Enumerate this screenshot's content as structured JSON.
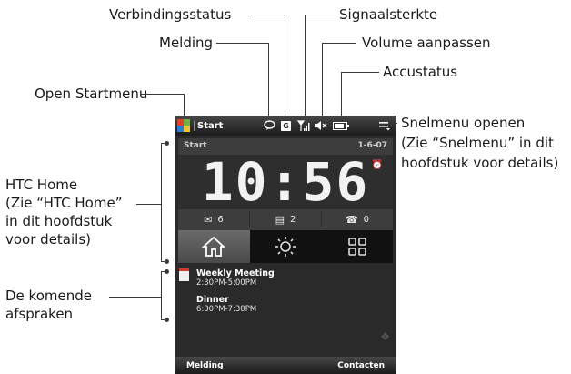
{
  "callouts": {
    "verbindingsstatus": "Verbindingsstatus",
    "signaalsterkte": "Signaalsterkte",
    "melding": "Melding",
    "volume": "Volume aanpassen",
    "accustatus": "Accustatus",
    "open_startmenu": "Open Startmenu",
    "snelmenu_l1": "Snelmenu openen",
    "snelmenu_l2": "(Zie “Snelmenu” in dit",
    "snelmenu_l3": "hoofdstuk voor details)",
    "htchome_l1": "HTC Home",
    "htchome_l2": "(Zie “HTC Home”",
    "htchome_l3": "in dit hoofdstuk",
    "htchome_l4": "voor details)",
    "afspraken_l1": "De komende",
    "afspraken_l2": "afspraken"
  },
  "phone": {
    "titlebar": {
      "start_label": "Start",
      "connection_letter": "G",
      "battery_level": 0.8
    },
    "home": {
      "header_left": "Start",
      "date": "1-6-07",
      "time": "10:56",
      "counts": {
        "messages": "6",
        "sms": "2",
        "missed_calls": "0"
      }
    },
    "tabs": [
      "home-icon",
      "weather-sun-icon",
      "launcher-grid-icon"
    ],
    "agenda": [
      {
        "title": "Weekly Meeting",
        "time": "2:30PM-5:00PM"
      },
      {
        "title": "Dinner",
        "time": "6:30PM-7:30PM"
      }
    ],
    "softkeys": {
      "left": "Melding",
      "right": "Contacten"
    }
  },
  "colors": {
    "line": "#3a3a3a",
    "phone_bg": "#2a2a2a"
  }
}
